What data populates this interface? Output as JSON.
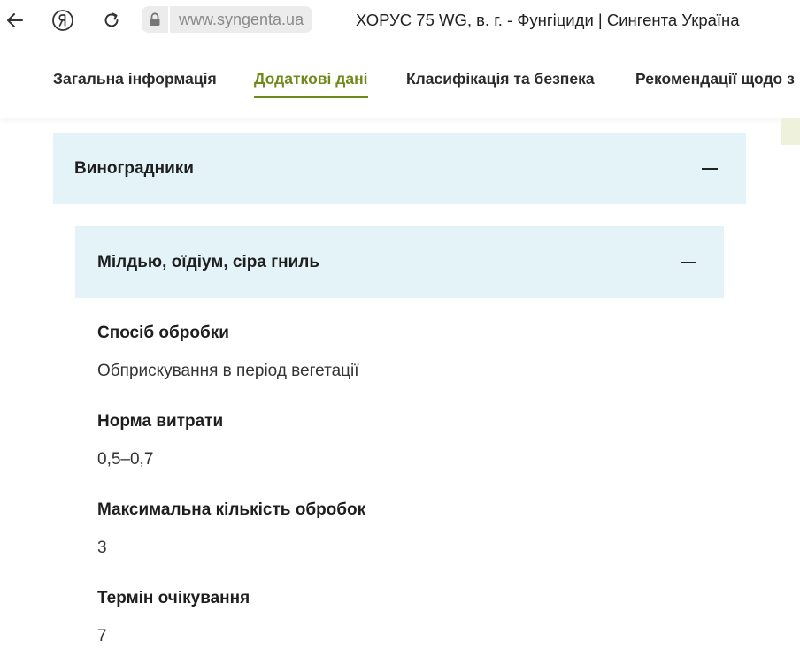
{
  "browser": {
    "url": "www.syngenta.ua",
    "page_title": "ХОРУС 75 WG, в. г. - Фунгіциди | Сингента Україна",
    "icons": [
      "back-arrow-icon",
      "yandex-icon",
      "reload-icon",
      "lock-icon"
    ]
  },
  "tabs": [
    {
      "label": "Загальна інформація",
      "active": false
    },
    {
      "label": "Додаткові дані",
      "active": true
    },
    {
      "label": "Класифікація та безпека",
      "active": false
    },
    {
      "label": "Рекомендації щодо з",
      "active": false
    }
  ],
  "accent_color": "#6f8a1a",
  "accordion": {
    "section_title": "Виноградники",
    "section_expanded": true,
    "subsection_title": "Мілдью, оїдіум, сіра гниль",
    "subsection_expanded": true,
    "panel_color": "#e3f3f7"
  },
  "details": [
    {
      "label": "Спосіб обробки",
      "value": "Обприскування в період вегетації"
    },
    {
      "label": "Норма витрати",
      "value": "0,5–0,7"
    },
    {
      "label": "Максимальна кількість обробок",
      "value": "3"
    },
    {
      "label": "Термін очікування",
      "value": "7"
    }
  ]
}
